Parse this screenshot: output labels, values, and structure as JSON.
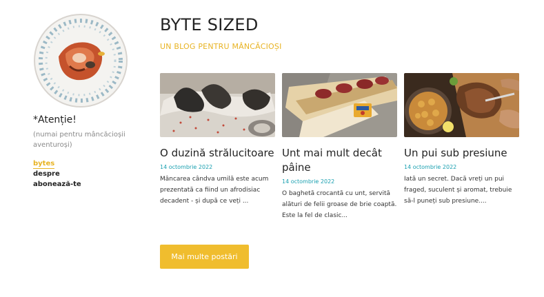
{
  "sidebar": {
    "warning_title": "*Atenție!",
    "warning_subtitle": "(numai pentru mâncăcioșii aventuroși)",
    "nav": [
      {
        "label": "bytes",
        "active": true
      },
      {
        "label": "despre",
        "active": false
      },
      {
        "label": "abonează-te",
        "active": false
      }
    ]
  },
  "header": {
    "title": "BYTE SIZED",
    "tagline": "UN BLOG PENTRU MÂNCĂCIOȘI"
  },
  "posts": [
    {
      "title": "O duzină strălucitoare",
      "date": "14 octombrie 2022",
      "excerpt": "Mâncarea cândva umilă este acum prezentată ca fiind un afrodisiac decadent - și după ce veți ..."
    },
    {
      "title": "Unt mai mult decât pâine",
      "date": "14 octombrie 2022",
      "excerpt": "O baghetă crocantă cu unt, servită alături de felii groase de brie coaptă. Este la fel de clasic..."
    },
    {
      "title": "Un pui sub presiune",
      "date": "14 octombrie 2022",
      "excerpt": "Iată un secret. Dacă vreți un pui fraged, suculent și aromat, trebuie să-l puneți sub presiune...."
    }
  ],
  "more_button": "Mai multe postări",
  "colors": {
    "accent": "#f0bd2e",
    "date": "#1aa0b0"
  }
}
